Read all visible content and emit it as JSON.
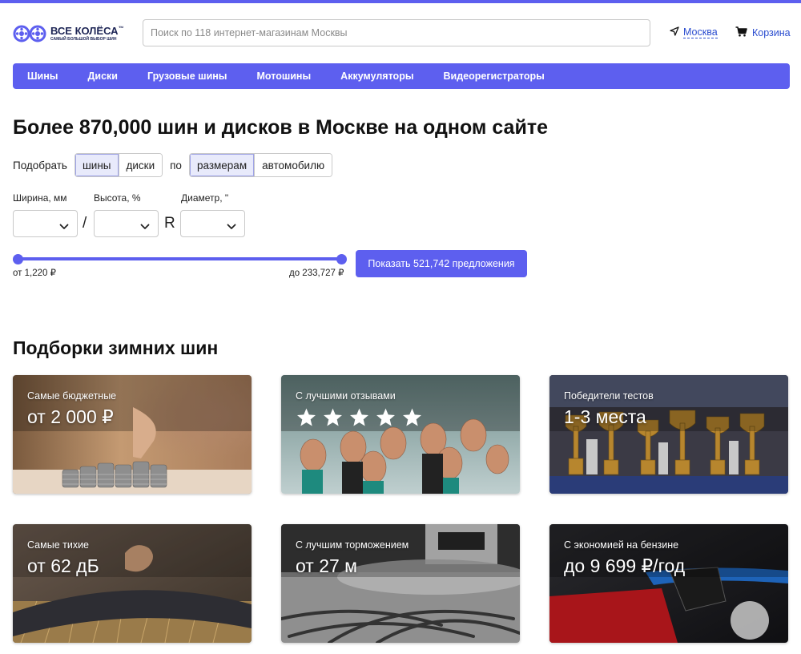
{
  "colors": {
    "accent": "#5d5fef",
    "link": "#2a4ccf",
    "text": "#111111"
  },
  "header": {
    "logo_title": "ВСЕ КОЛЁСА",
    "logo_tm": "™",
    "logo_subtitle": "САМЫЙ БОЛЬШОЙ ВЫБОР ШИН",
    "search_placeholder": "Поиск по 118 интернет-магазинам Москвы",
    "city": "Москва",
    "city_icon": "location-arrow-icon",
    "cart": "Корзина",
    "cart_icon": "cart-icon"
  },
  "nav": {
    "items": [
      {
        "label": "Шины"
      },
      {
        "label": "Диски"
      },
      {
        "label": "Грузовые шины"
      },
      {
        "label": "Мотошины"
      },
      {
        "label": "Аккумуляторы"
      },
      {
        "label": "Видеорегистраторы"
      }
    ]
  },
  "hero": {
    "title": "Более 870,000 шин и дисков в Москве на одном сайте",
    "pick_label": "Подобрать",
    "type_options": [
      {
        "label": "шины",
        "active": true
      },
      {
        "label": "диски",
        "active": false
      }
    ],
    "by_label": "по",
    "mode_options": [
      {
        "label": "размерам",
        "active": true
      },
      {
        "label": "автомобилю",
        "active": false
      }
    ],
    "width_label": "Ширина, мм",
    "height_label": "Высота, %",
    "diameter_label": "Диаметр, \"",
    "slash": "/",
    "r_label": "R",
    "width_value": "",
    "height_value": "",
    "diameter_value": "",
    "price_from": "от 1,220 ₽",
    "price_to": "до 233,727 ₽",
    "slider_range": [
      0,
      1
    ],
    "show_button": "Показать 521,742 предложения"
  },
  "collections": {
    "title": "Подборки зимних шин",
    "cards": [
      {
        "label": "Самые бюджетные",
        "value": "от 2 000 ₽"
      },
      {
        "label": "С лучшими отзывами",
        "value": "",
        "stars": 5
      },
      {
        "label": "Победители тестов",
        "value": "1-3 места"
      },
      {
        "label": "Самые тихие",
        "value": "от 62 дБ"
      },
      {
        "label": "С лучшим торможением",
        "value": "от 27 м"
      },
      {
        "label": "С экономией на бензине",
        "value": "до 9 699 ₽/год"
      }
    ]
  }
}
